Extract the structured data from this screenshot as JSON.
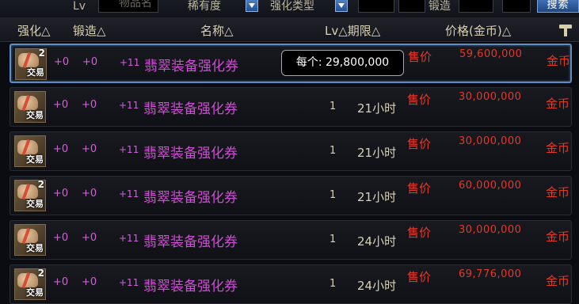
{
  "filter_bar": {
    "lv_label": "Lv",
    "name_label": "物品名",
    "rarity_label": "稀有度",
    "enhance_type_label": "强化类型",
    "forge_label": "锻造",
    "search_label": "搜索"
  },
  "columns": {
    "enhance": "强化△",
    "forge": "锻造△",
    "name": "名称△",
    "lv_duration": "Lv△期限△",
    "price": "价格(金币)△"
  },
  "rows": [
    {
      "icon_count": "2",
      "icon_trade": "交易",
      "enhance": "+0",
      "forge": "+0",
      "plus": "+11",
      "name": "翡翠装备强化券",
      "lv": "",
      "duration": "",
      "sell_label": "售价",
      "price": "59,600,000",
      "currency": "金币"
    },
    {
      "icon_count": "",
      "icon_trade": "交易",
      "enhance": "+0",
      "forge": "+0",
      "plus": "+11",
      "name": "翡翠装备强化券",
      "lv": "1",
      "duration": "21小时",
      "sell_label": "售价",
      "price": "30,000,000",
      "currency": "金币"
    },
    {
      "icon_count": "",
      "icon_trade": "交易",
      "enhance": "+0",
      "forge": "+0",
      "plus": "+11",
      "name": "翡翠装备强化券",
      "lv": "1",
      "duration": "21小时",
      "sell_label": "售价",
      "price": "30,000,000",
      "currency": "金币"
    },
    {
      "icon_count": "2",
      "icon_trade": "交易",
      "enhance": "+0",
      "forge": "+0",
      "plus": "+11",
      "name": "翡翠装备强化券",
      "lv": "1",
      "duration": "21小时",
      "sell_label": "售价",
      "price": "60,000,000",
      "currency": "金币"
    },
    {
      "icon_count": "",
      "icon_trade": "交易",
      "enhance": "+0",
      "forge": "+0",
      "plus": "+11",
      "name": "翡翠装备强化券",
      "lv": "1",
      "duration": "24小时",
      "sell_label": "售价",
      "price": "30,000,000",
      "currency": "金币"
    },
    {
      "icon_count": "2",
      "icon_trade": "交易",
      "enhance": "+0",
      "forge": "+0",
      "plus": "+11",
      "name": "翡翠装备强化券",
      "lv": "1",
      "duration": "24小时",
      "sell_label": "售价",
      "price": "69,776,000",
      "currency": "金币"
    }
  ],
  "tooltip": {
    "text": "每个: 29,800,000"
  },
  "colors": {
    "accent_blue": "#5f8ec2",
    "item_name": "#d14bd6",
    "price_red": "#e03a2a"
  }
}
